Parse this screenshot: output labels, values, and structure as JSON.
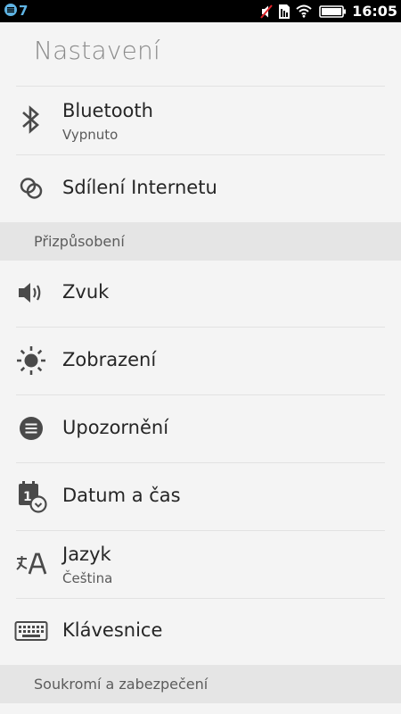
{
  "status_bar": {
    "notification_count": "7",
    "time": "16:05",
    "icons": [
      "notification-icon",
      "muted-icon",
      "sim-icon",
      "wifi-icon",
      "battery-icon"
    ]
  },
  "header": {
    "title": "Nastavení"
  },
  "settings": {
    "bluetooth": {
      "label": "Bluetooth",
      "sub": "Vypnuto",
      "icon": "bluetooth-icon"
    },
    "tethering": {
      "label": "Sdílení Internetu",
      "icon": "link-icon"
    },
    "section_personalization": "Přizpůsobení",
    "sound": {
      "label": "Zvuk",
      "icon": "speaker-icon"
    },
    "display": {
      "label": "Zobrazení",
      "icon": "brightness-icon"
    },
    "notifications": {
      "label": "Upozornění",
      "icon": "notifications-icon"
    },
    "datetime": {
      "label": "Datum a čas",
      "icon": "calendar-clock-icon",
      "calendar_day": "1"
    },
    "language": {
      "label": "Jazyk",
      "sub": "Čeština",
      "icon": "language-icon"
    },
    "keyboard": {
      "label": "Klávesnice",
      "icon": "keyboard-icon"
    },
    "section_privacy": "Soukromí a zabezpečení"
  },
  "colors": {
    "status_bar_bg": "#000000",
    "accent_blue": "#5fb4e4",
    "background": "#f4f4f4",
    "section_bg": "#e5e5e5",
    "icon_gray": "#4a4a4a"
  }
}
